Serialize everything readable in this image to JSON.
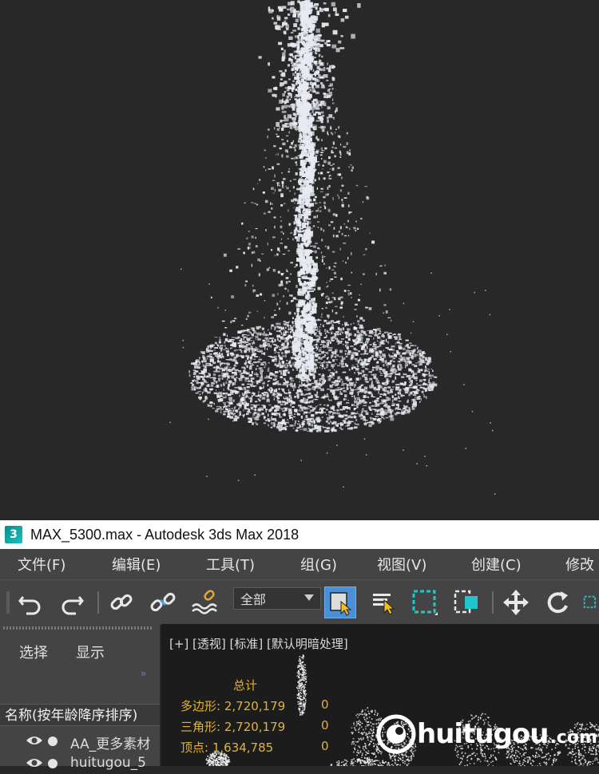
{
  "window": {
    "title": "MAX_5300.max - Autodesk 3ds Max 2018",
    "app_icon_label": "3"
  },
  "menu": {
    "items": [
      "文件(F)",
      "编辑(E)",
      "工具(T)",
      "组(G)",
      "视图(V)",
      "创建(C)",
      "修改"
    ]
  },
  "toolbar": {
    "icons": [
      "undo-icon",
      "redo-icon",
      "link-icon",
      "unlink-icon",
      "bind-space-warp-icon",
      "select-object-icon",
      "select-by-name-icon",
      "rectangular-selection-region-icon",
      "window-crossing-icon",
      "move-icon",
      "rotate-icon",
      "scale-icon"
    ],
    "selection_filter": "全部"
  },
  "scene_explorer": {
    "tabs": [
      "选择",
      "显示"
    ],
    "column_header": "名称(按年龄降序排序)",
    "items": [
      "AA_更多素材",
      "huitugou_5"
    ]
  },
  "viewport": {
    "label": "[+] [透视] [标准] [默认明暗处理]",
    "stats": {
      "title": "总计",
      "rows": [
        {
          "label": "多边形:",
          "total": "2,720,179",
          "selected": "0"
        },
        {
          "label": "三角形:",
          "total": "2,720,179",
          "selected": "0"
        },
        {
          "label": "顶点:",
          "total": "1,634,785",
          "selected": "0"
        }
      ]
    }
  },
  "watermark": {
    "text": "huitugou",
    "suffix": ".com"
  },
  "colors": {
    "ui_panel": "#444444",
    "viewport_bg": "#1c1c1c",
    "render_bg": "#282828",
    "stats_text": "#e0b43a",
    "accent_blue": "#4a90d9",
    "highlight_teal": "#23c6c6"
  }
}
